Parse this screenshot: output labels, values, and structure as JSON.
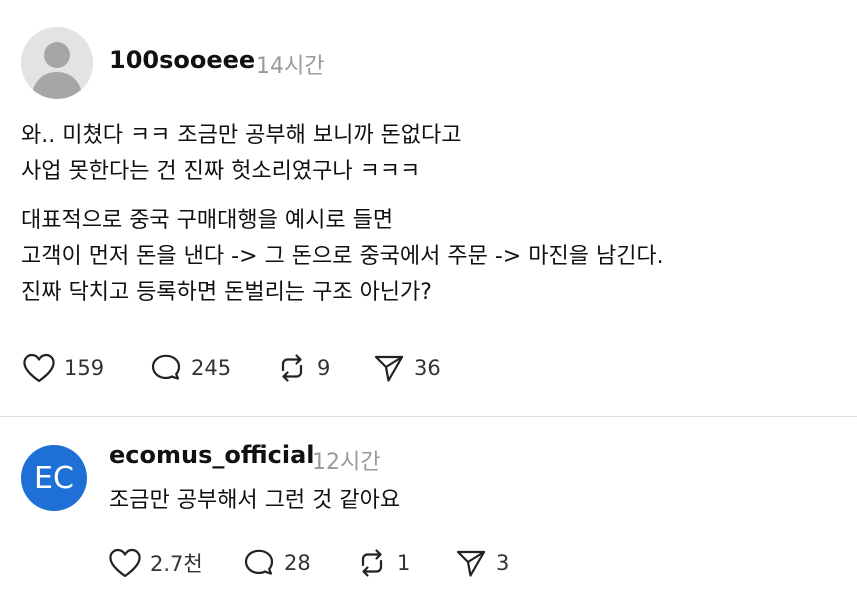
{
  "post": {
    "username": "100sooeee",
    "time": "14시간",
    "paragraphs": [
      [
        "와.. 미쳤다 ㅋㅋ 조금만 공부해 보니까 돈없다고",
        "사업 못한다는 건 진짜 헛소리였구나 ㅋㅋㅋ"
      ],
      [
        "대표적으로 중국 구매대행을 예시로 들면",
        "고객이 먼저 돈을 낸다 -> 그 돈으로 중국에서 주문 -> 마진을 남긴다.",
        "진짜 닥치고 등록하면 돈벌리는 구조 아닌가?"
      ]
    ],
    "actions": {
      "likes": "159",
      "comments": "245",
      "reposts": "9",
      "shares": "36"
    }
  },
  "reply": {
    "avatar_text": "EC",
    "username": "ecomus_official",
    "time": "12시간",
    "text": "조금만 공부해서 그런 것 같아요",
    "actions": {
      "likes": "2.7천",
      "comments": "28",
      "reposts": "1",
      "shares": "3"
    }
  },
  "colors": {
    "reply_avatar": "#1e6fd6",
    "time_text": "#9a9a9a",
    "avatar_placeholder": "#e3e3e3"
  },
  "icons": {
    "like": "heart-icon",
    "comment": "speech-bubble-icon",
    "repost": "repost-icon",
    "share": "paper-plane-icon"
  }
}
